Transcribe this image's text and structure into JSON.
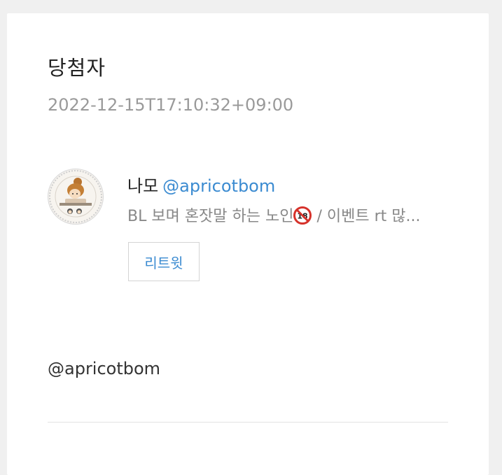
{
  "post": {
    "title": "당첨자",
    "timestamp": "2022-12-15T17:10:32+09:00",
    "mention": "@apricotbom"
  },
  "user": {
    "display_name": "나모",
    "handle": "@apricotbom",
    "bio_before_emoji": "BL 보며 혼잣말 하는 노인",
    "bio_after_emoji": " / 이벤트 rt 많...",
    "bio_emoji_icon": "no-under-18-icon",
    "avatar_icon": "avatar-illustration"
  },
  "actions": {
    "retweet_label": "리트윗"
  },
  "colors": {
    "link": "#3b8bd1",
    "muted": "#9a9a9a",
    "background": "#f0f0f0",
    "card": "#ffffff"
  }
}
